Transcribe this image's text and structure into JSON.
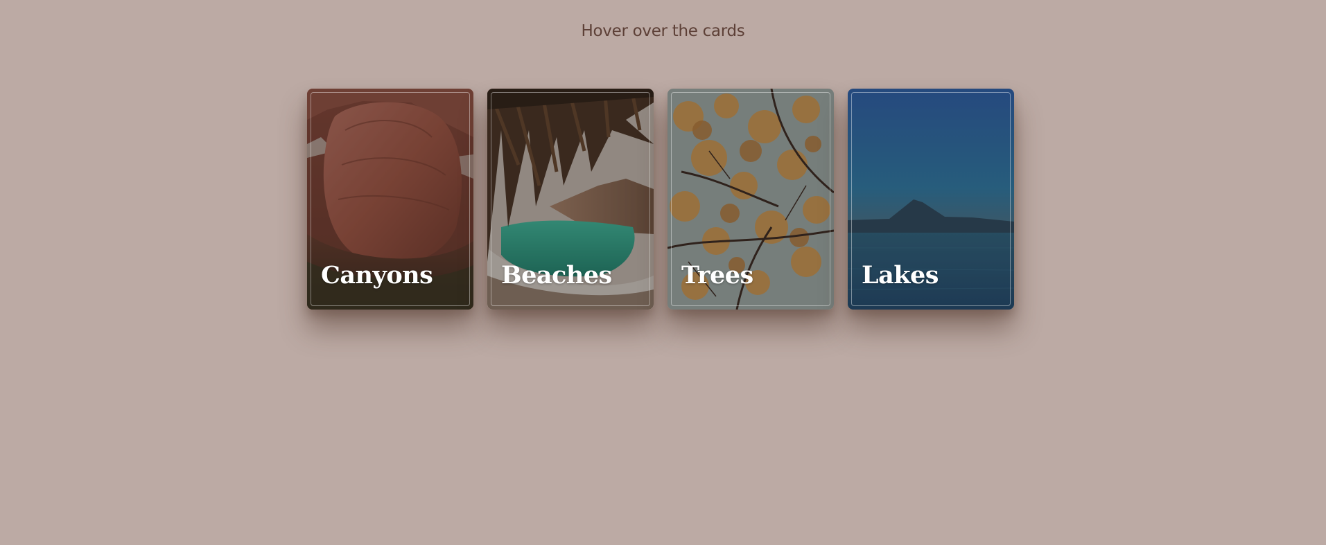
{
  "page": {
    "heading": "Hover over the cards",
    "background": "#bcaaa4",
    "heading_color": "#5d4037"
  },
  "cards": [
    {
      "title": "Canyons",
      "image": "red-rock-canyon-photo"
    },
    {
      "title": "Beaches",
      "image": "palm-beach-cove-photo"
    },
    {
      "title": "Trees",
      "image": "autumn-leaves-branches-photo"
    },
    {
      "title": "Lakes",
      "image": "lake-mountain-dusk-photo"
    }
  ]
}
